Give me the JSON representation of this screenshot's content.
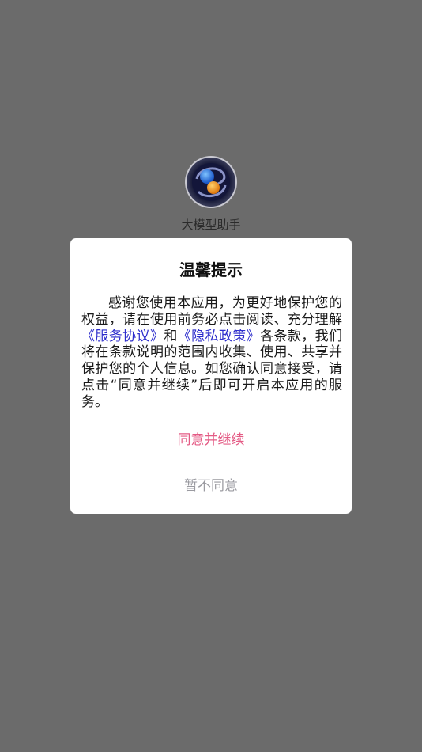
{
  "app": {
    "name": "大模型助手",
    "logo_icon": "app-logo-icon"
  },
  "dialog": {
    "title": "温馨提示",
    "body_before": "感谢您使用本应用，为更好地保护您的权益，请在使用前务必点击阅读、充分理解",
    "service_link": "《服务协议》",
    "body_and": "和",
    "privacy_link": "《隐私政策》",
    "body_after": "各条款，我们将在条款说明的范围内收集、使用、共享并保护您的个人信息。如您确认同意接受，请点击“同意并继续”后即可开启本应用的服务。",
    "agree_label": "同意并继续",
    "decline_label": "暂不同意"
  },
  "colors": {
    "overlay": "#6b6b6b",
    "link": "#2c2ccc",
    "agree": "#e45b85",
    "decline": "#9a9aa0"
  }
}
